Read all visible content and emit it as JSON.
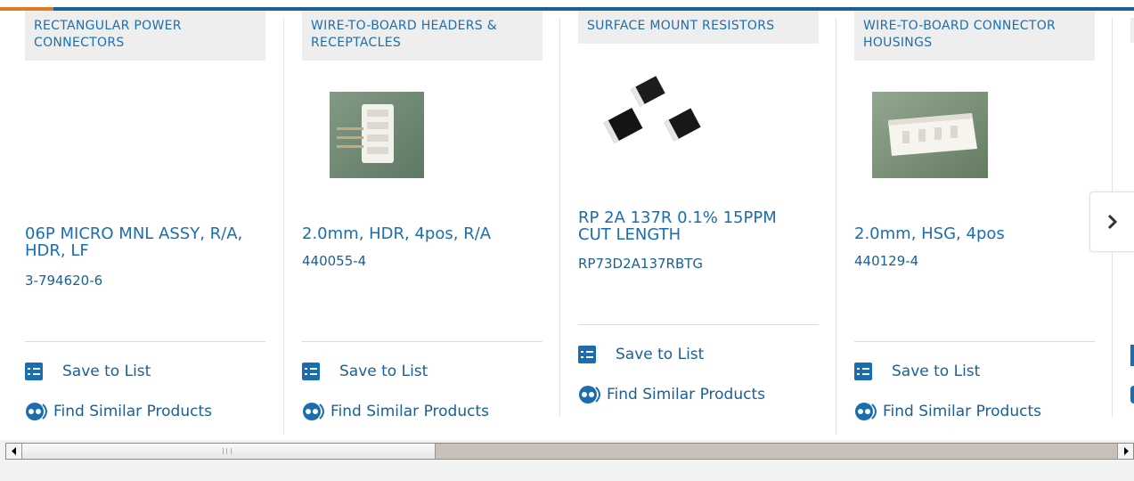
{
  "products": [
    {
      "category": "RECTANGULAR POWER CONNECTORS",
      "title": "06P MICRO MNL ASSY, R/A, HDR, LF",
      "part_number": "3-794620-6",
      "save_label": "Save to List",
      "similar_label": "Find Similar Products",
      "has_image": false
    },
    {
      "category": "WIRE-TO-BOARD HEADERS & RECEPTACLES",
      "title": "2.0mm, HDR, 4pos, R/A",
      "part_number": "440055-4",
      "save_label": "Save to List",
      "similar_label": "Find Similar Products",
      "has_image": true
    },
    {
      "category": "SURFACE MOUNT RESISTORS",
      "title": "RP 2A 137R 0.1% 15PPM CUT LENGTH",
      "part_number": "RP73D2A137RBTG",
      "save_label": "Save to List",
      "similar_label": "Find Similar Products",
      "has_image": true
    },
    {
      "category": "WIRE-TO-BOARD CONNECTOR HOUSINGS",
      "title": "2.0mm, HSG, 4pos",
      "part_number": "440129-4",
      "save_label": "Save to List",
      "similar_label": "Find Similar Products",
      "has_image": true
    }
  ],
  "colors": {
    "accent_blue": "#1a5f97",
    "link_blue": "#1a6eb0",
    "accent_orange": "#e07a1f",
    "category_bg": "#eeeeee"
  },
  "icons": {
    "save": "list-check-icon",
    "similar": "similar-products-icon",
    "next": "chevron-right-icon"
  }
}
